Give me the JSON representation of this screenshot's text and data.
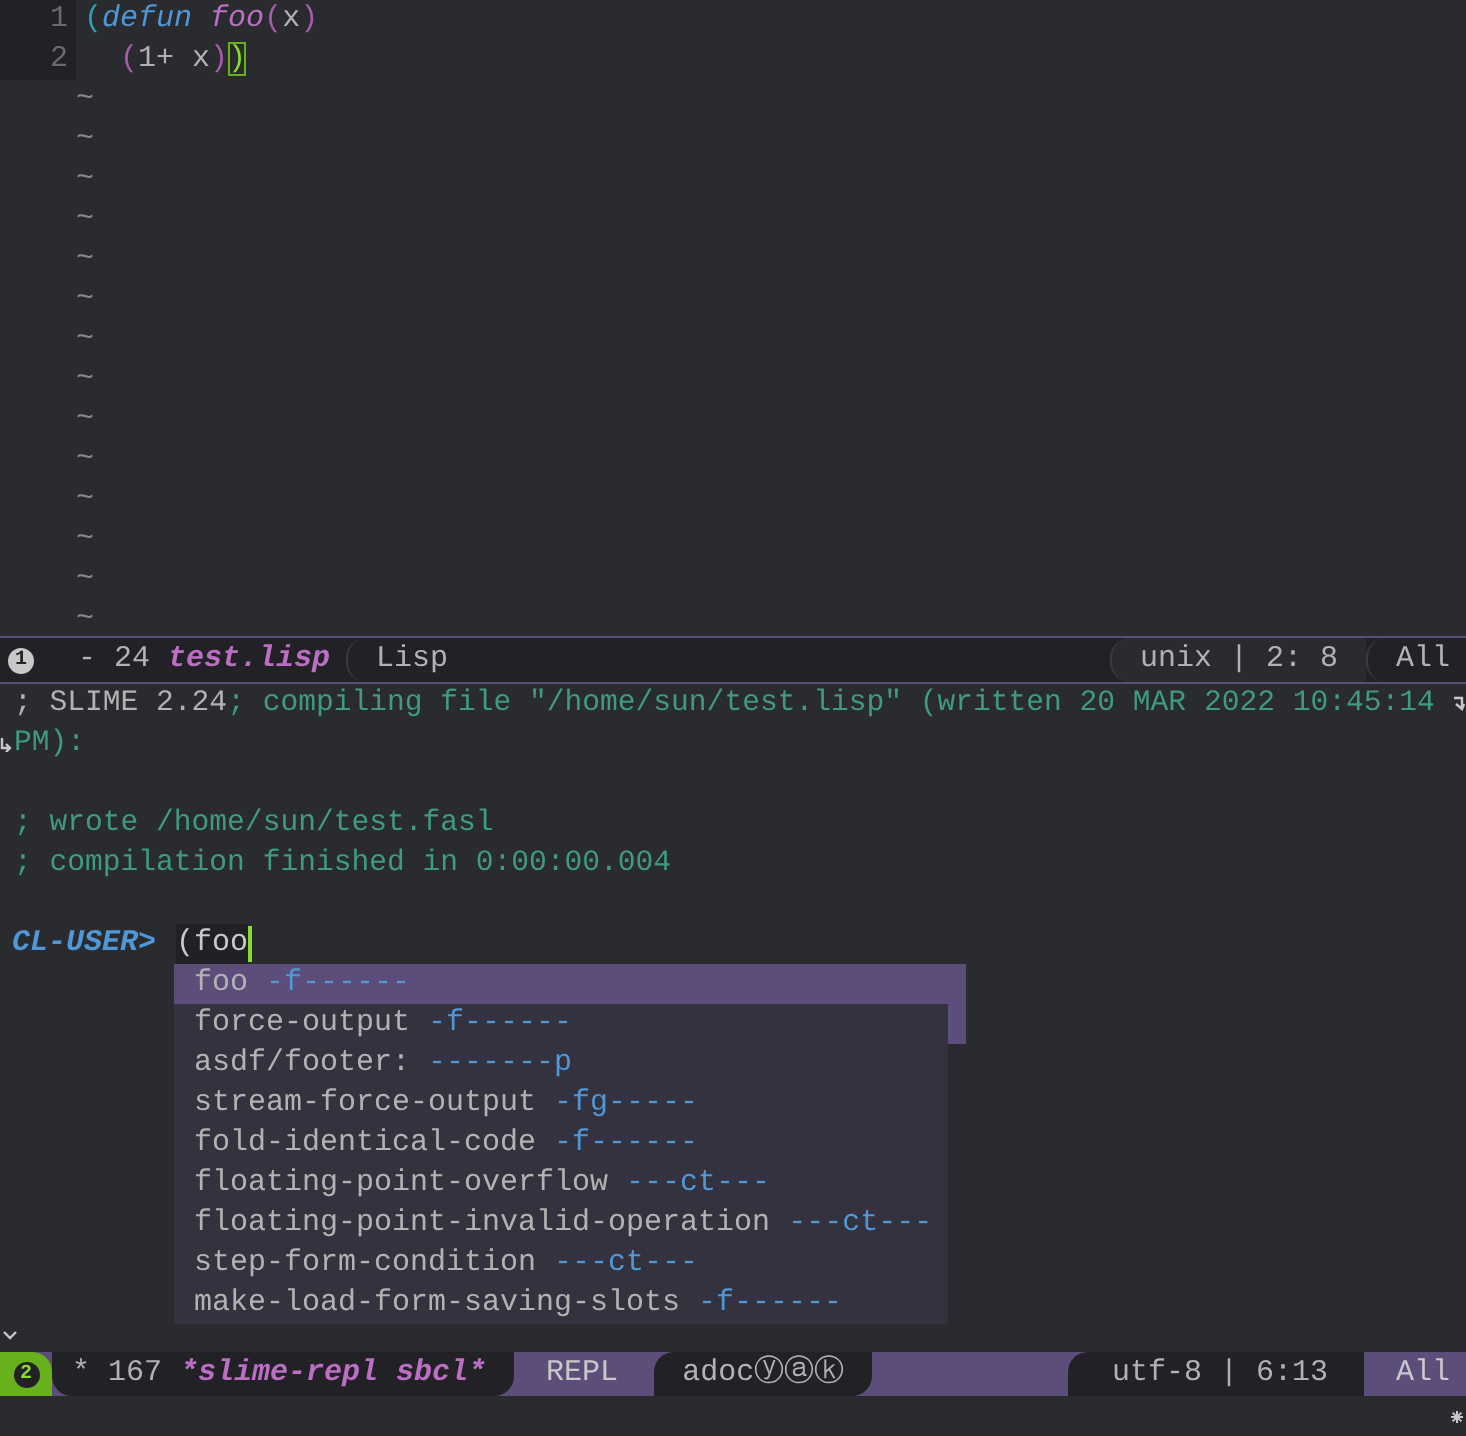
{
  "editor": {
    "lines": [
      {
        "number": "1",
        "tokens": [
          {
            "text": "(",
            "kind": "paren-outer"
          },
          {
            "text": "defun",
            "kind": "keyword"
          },
          {
            "text": " foo",
            "kind": "function"
          },
          {
            "text": "(",
            "kind": "paren"
          },
          {
            "text": "x",
            "kind": "plain"
          },
          {
            "text": ")",
            "kind": "paren"
          }
        ]
      },
      {
        "number": "2",
        "tokens": [
          {
            "text": "  (",
            "kind": "paren"
          },
          {
            "text": "1+ x",
            "kind": "plain"
          },
          {
            "text": ")",
            "kind": "paren"
          },
          {
            "text": ")",
            "kind": "paren-match"
          }
        ]
      }
    ],
    "empty_line_markers": [
      "~",
      "~",
      "~",
      "~",
      "~",
      "~",
      "~",
      "~",
      "~",
      "~",
      "~",
      "~",
      "~",
      "~"
    ]
  },
  "mode_line_1": {
    "window_number": "1",
    "modified": "- 24",
    "buffer": "test.lisp",
    "major_mode": "Lisp",
    "encoding": "unix | 2: 8",
    "position": "All"
  },
  "repl": {
    "output": [
      {
        "segments": [
          {
            "text": "; SLIME 2.24",
            "kind": "plain"
          },
          {
            "text": "; compiling file \"/home/sun/test.lisp\" (written 20 MAR 2022 10:45:14 PM):",
            "kind": "comment"
          }
        ]
      },
      {
        "kind": "blank"
      },
      {
        "segments": [
          {
            "text": "; wrote /home/sun/test.fasl",
            "kind": "comment"
          }
        ]
      },
      {
        "segments": [
          {
            "text": "; compilation finished in 0:00:00.004",
            "kind": "comment"
          }
        ]
      },
      {
        "kind": "blank"
      }
    ],
    "prompt": "CL-USER>",
    "input": "(foo",
    "completions": [
      {
        "name": "foo",
        "flags": "-f------",
        "selected": true
      },
      {
        "name": "force-output",
        "flags": "-f------",
        "selected": false
      },
      {
        "name": "asdf/footer:",
        "flags": "-------p",
        "selected": false
      },
      {
        "name": "stream-force-output",
        "flags": "-fg-----",
        "selected": false
      },
      {
        "name": "fold-identical-code",
        "flags": "-f------",
        "selected": false
      },
      {
        "name": "floating-point-overflow",
        "flags": "---ct---",
        "selected": false
      },
      {
        "name": "floating-point-invalid-operation",
        "flags": "---ct---",
        "selected": false
      },
      {
        "name": "step-form-condition",
        "flags": "---ct---",
        "selected": false
      },
      {
        "name": "make-load-form-saving-slots",
        "flags": "-f------",
        "selected": false
      }
    ]
  },
  "mode_line_2": {
    "window_number": "2",
    "modified": "* 167",
    "buffer": "*slime-repl sbcl*",
    "major_mode": "REPL",
    "minor_modes": "adocⓨⓐⓚ",
    "encoding": "utf-8 | 6:13",
    "position": "All"
  }
}
